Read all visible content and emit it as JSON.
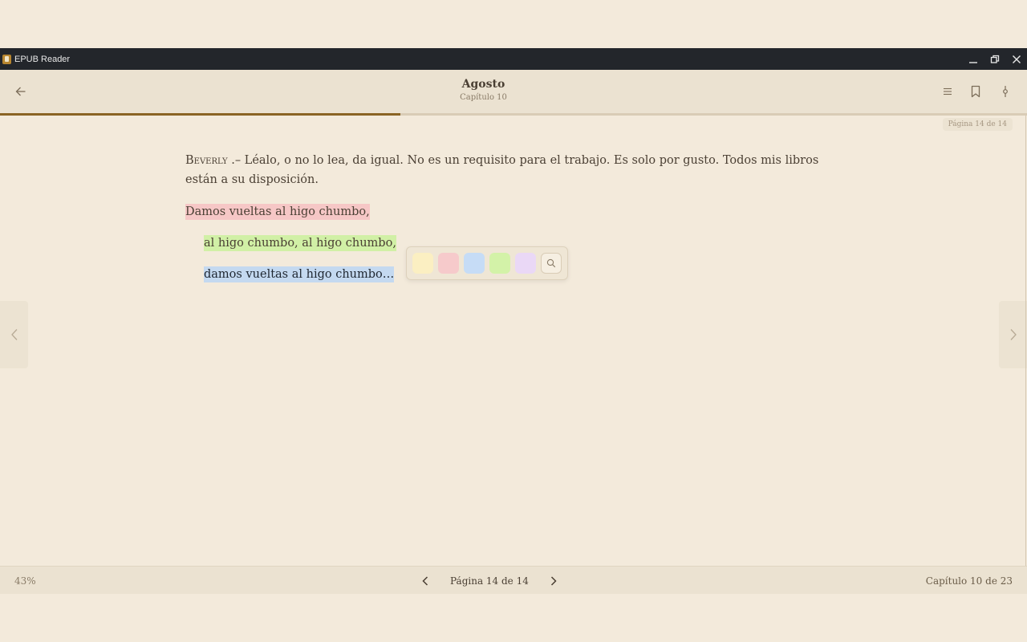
{
  "window": {
    "title": "EPUB Reader",
    "controls": [
      "minimize-icon",
      "restore-icon",
      "close-icon"
    ]
  },
  "header": {
    "title": "Agosto",
    "subtitle": "Capítulo 10",
    "icons": [
      "back-arrow-icon",
      "toc-list-icon",
      "bookmark-icon",
      "text-settings-icon"
    ]
  },
  "progress": {
    "fraction": 0.39,
    "color": "#8a6424"
  },
  "page_badge": "Página 14 de 14",
  "content": {
    "speaker": "Beverly",
    "speaker_suffix": " .– Léalo, o no lo lea, da igual. No es un requisito para el trabajo. Es solo por gusto. Todos mis libros están a su disposición.",
    "verses": [
      {
        "text": "Damos vueltas al higo chumbo,",
        "highlight": "pink"
      },
      {
        "text": "al higo chumbo, al higo chumbo,",
        "highlight": "green"
      },
      {
        "text": "damos vueltas al higo chumbo…",
        "highlight": "blue"
      }
    ]
  },
  "highlight_toolbar": {
    "swatches": [
      {
        "name": "yellow",
        "color": "#fbefc2"
      },
      {
        "name": "pink",
        "color": "#f6cacb"
      },
      {
        "name": "blue",
        "color": "#c6dcf6"
      },
      {
        "name": "green",
        "color": "#d3f2a8"
      },
      {
        "name": "purple",
        "color": "#ead8f6"
      }
    ],
    "action_icon": "search-icon"
  },
  "side_nav": {
    "prev_icon": "chevron-left-icon",
    "next_icon": "chevron-right-icon"
  },
  "footer": {
    "percent": "43%",
    "page_label": "Página 14 de 14",
    "chapter_label": "Capítulo 10 de 23"
  }
}
